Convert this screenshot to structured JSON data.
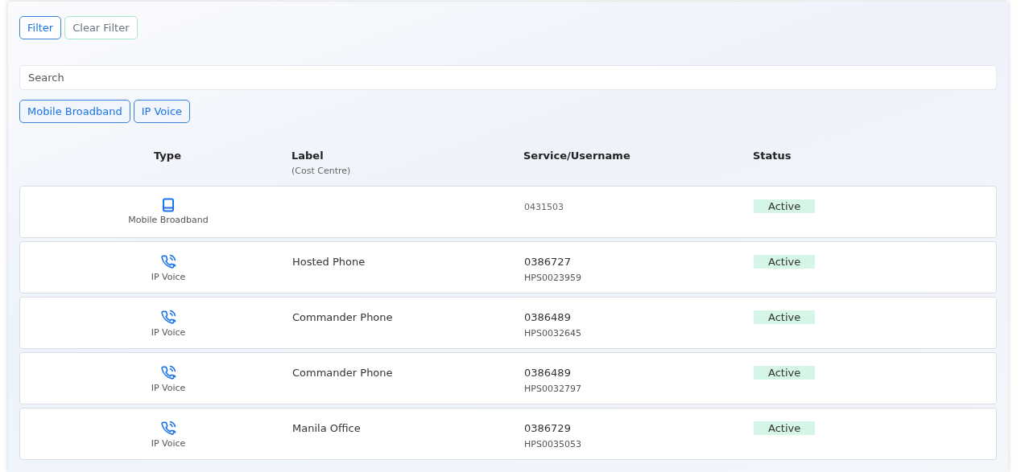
{
  "filter_buttons": [
    {
      "label": "Filter",
      "kind": "primary"
    },
    {
      "label": "Clear Filter",
      "kind": "secondary"
    }
  ],
  "search": {
    "placeholder": "Search"
  },
  "type_filters": [
    "Mobile Broadband",
    "IP Voice"
  ],
  "table": {
    "columns": [
      {
        "title": "Type"
      },
      {
        "title": "Label",
        "subtitle": "(Cost Centre)"
      },
      {
        "title": "Service/Username"
      },
      {
        "title": "Status"
      }
    ],
    "rows": [
      {
        "kind": "mobile_broadband",
        "type": "Mobile Broadband",
        "label": "",
        "service": "0431503",
        "service_muted": true,
        "status": "Active"
      },
      {
        "kind": "ip_voice",
        "type": "IP Voice",
        "label": "Hosted Phone",
        "service": "0386727",
        "username": "HPS0023959",
        "status": "Active"
      },
      {
        "kind": "ip_voice",
        "type": "IP Voice",
        "label": "Commander Phone",
        "service": "0386489",
        "username": "HPS0032645",
        "status": "Active"
      },
      {
        "kind": "ip_voice",
        "type": "IP Voice",
        "label": "Commander Phone",
        "service": "0386489",
        "username": "HPS0032797",
        "status": "Active"
      },
      {
        "kind": "ip_voice",
        "type": "IP Voice",
        "label": "Manila Office",
        "service": "0386729",
        "username": "HPS0035053",
        "status": "Active"
      }
    ]
  }
}
